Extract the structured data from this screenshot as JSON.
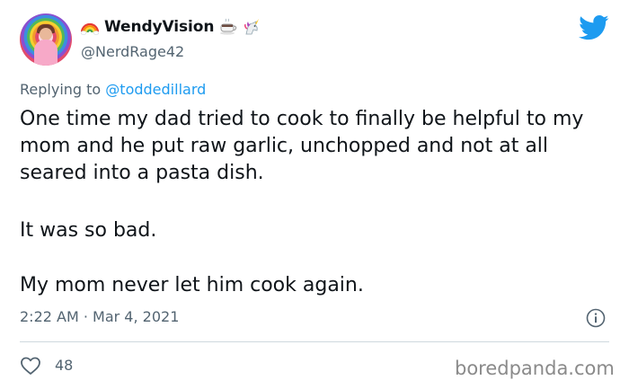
{
  "author": {
    "display_name": "WendyVision",
    "handle": "@NerdRage42",
    "name_emojis": [
      "rainbow-icon",
      "coffee-cup-icon",
      "unicorn-icon"
    ]
  },
  "reply": {
    "prefix": "Replying to",
    "mention": "@toddedillard"
  },
  "tweet": {
    "paragraphs": [
      "One time my dad tried to cook to finally be helpful to my mom and he put raw garlic, unchopped and not at all seared into a pasta dish.",
      "It was so bad.",
      "My mom never let him cook again."
    ],
    "timestamp": "2:22 AM · Mar 4, 2021",
    "like_count": "48"
  },
  "colors": {
    "twitter_blue": "#1d9bf0",
    "secondary_text": "#536471",
    "primary_text": "#0f1419"
  },
  "watermark": "boredpanda.com"
}
